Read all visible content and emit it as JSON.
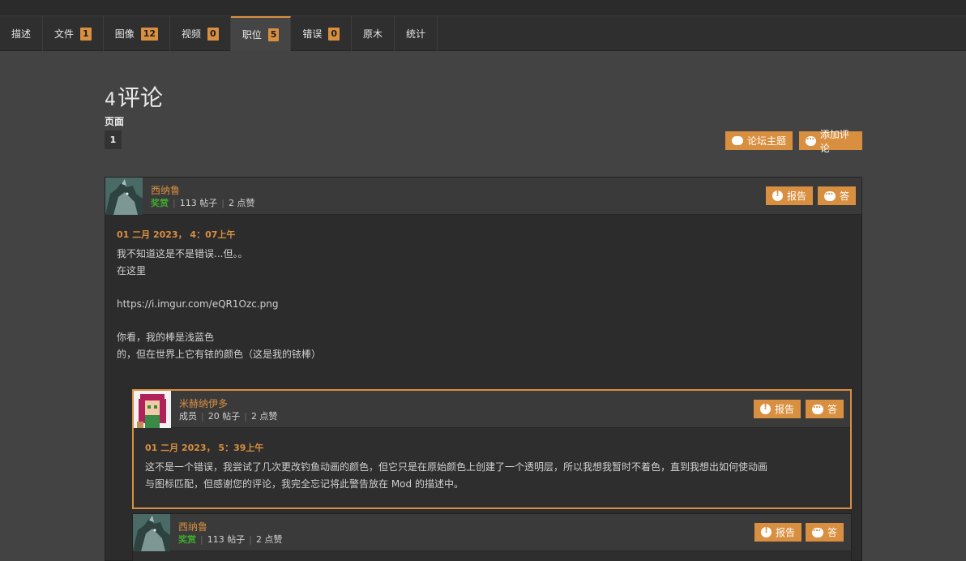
{
  "tabs": [
    {
      "label": "描述",
      "count": null
    },
    {
      "label": "文件",
      "count": "1"
    },
    {
      "label": "图像",
      "count": "12"
    },
    {
      "label": "视频",
      "count": "0"
    },
    {
      "label": "职位",
      "count": "5"
    },
    {
      "label": "错误",
      "count": "0"
    },
    {
      "label": "原木",
      "count": null
    },
    {
      "label": "统计",
      "count": null
    }
  ],
  "page": {
    "count": "4",
    "title": "评论",
    "pages_label": "页面",
    "current_page": "1",
    "forum_topic_label": "论坛主题",
    "add_comment_label": "添加评论"
  },
  "comments": [
    {
      "author": "西纳鲁",
      "role": "奖赏",
      "posts": "113 帖子",
      "kudos": "2 点赞",
      "date": "01 二月 2023， 4：07上午",
      "body": [
        "我不知道这是不是错误...但。。",
        "在这里",
        "",
        "https://i.imgur.com/eQR1Ozc.png",
        "",
        "你看，我的棒是浅蓝色",
        "的，但在世界上它有铱的颜色（这是我的铱棒）"
      ],
      "report_label": "报告",
      "reply_label": "答"
    },
    {
      "author": "米赫纳伊多",
      "role": "成员",
      "posts": "20 帖子",
      "kudos": "2 点赞",
      "date": "01 二月 2023， 5：39上午",
      "body": [
        "这不是一个错误，我尝试了几次更改钓鱼动画的颜色，但它只是在原始颜色上创建了一个透明层，所以我想我暂时不着色，直到我想出如何使动画",
        "与图标匹配，但感谢您的评论，我完全忘记将此警告放在 Mod 的描述中。"
      ],
      "report_label": "报告",
      "reply_label": "答"
    },
    {
      "author": "西纳鲁",
      "role": "奖赏",
      "posts": "113 帖子",
      "kudos": "2 点赞",
      "report_label": "报告",
      "reply_label": "答"
    }
  ],
  "colors": {
    "accent": "#d98f40",
    "role_green": "#3fa82f",
    "background": "#434343"
  }
}
